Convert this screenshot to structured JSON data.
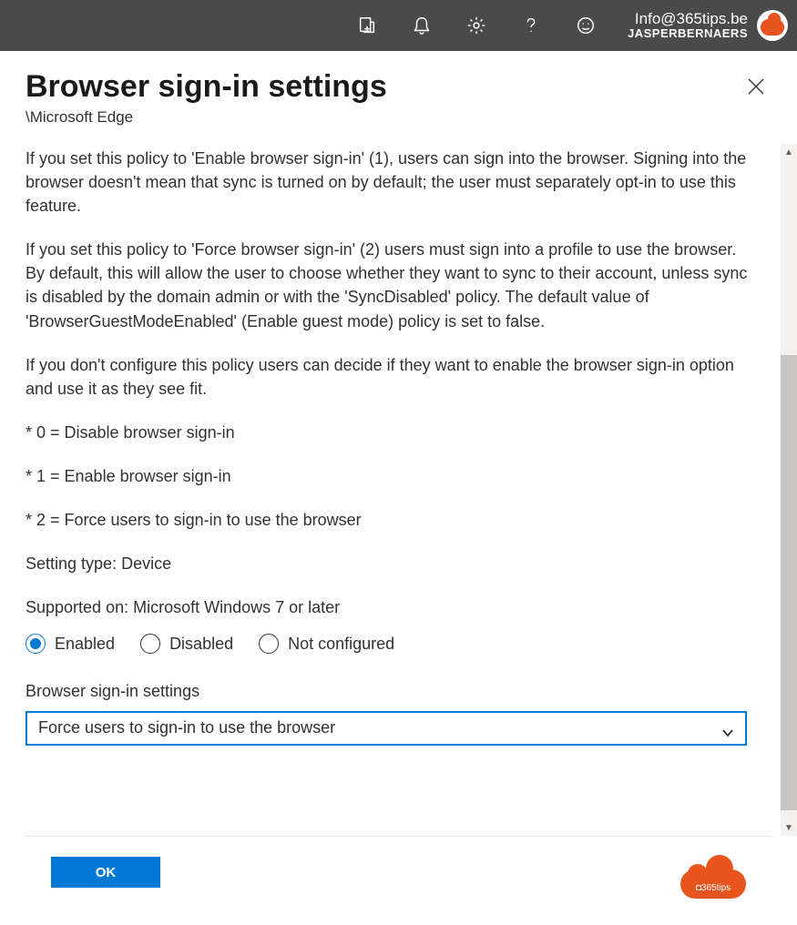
{
  "topbar": {
    "email": "Info@365tips.be",
    "tenant": "JASPERBERNAERS"
  },
  "panel": {
    "title": "Browser sign-in settings",
    "breadcrumb": "\\Microsoft Edge"
  },
  "description": {
    "p1": "If you set this policy to 'Enable browser sign-in' (1), users can sign into the browser. Signing into the browser doesn't mean that sync is turned on by default; the user must separately opt-in to use this feature.",
    "p2": "If you set this policy to 'Force browser sign-in' (2) users must sign into a profile to use the browser. By default, this will allow the user to choose whether they want to sync to their account, unless sync is disabled by the domain admin or with the 'SyncDisabled' policy. The default value of 'BrowserGuestModeEnabled' (Enable guest mode) policy is set to false.",
    "p3": "If you don't configure this policy users can decide if they want to enable the browser sign-in option and use it as they see fit.",
    "b0": "* 0 = Disable browser sign-in",
    "b1": "* 1 = Enable browser sign-in",
    "b2": "* 2 = Force users to sign-in to use the browser",
    "setting_type": "Setting type: Device",
    "supported": "Supported on: Microsoft Windows 7 or later"
  },
  "radios": {
    "enabled": "Enabled",
    "disabled": "Disabled",
    "not_configured": "Not configured",
    "selected": "enabled"
  },
  "dropdown": {
    "label": "Browser sign-in settings",
    "value": "Force users to sign-in to use the browser"
  },
  "footer": {
    "ok": "OK",
    "logo_text": "◘365tips"
  }
}
